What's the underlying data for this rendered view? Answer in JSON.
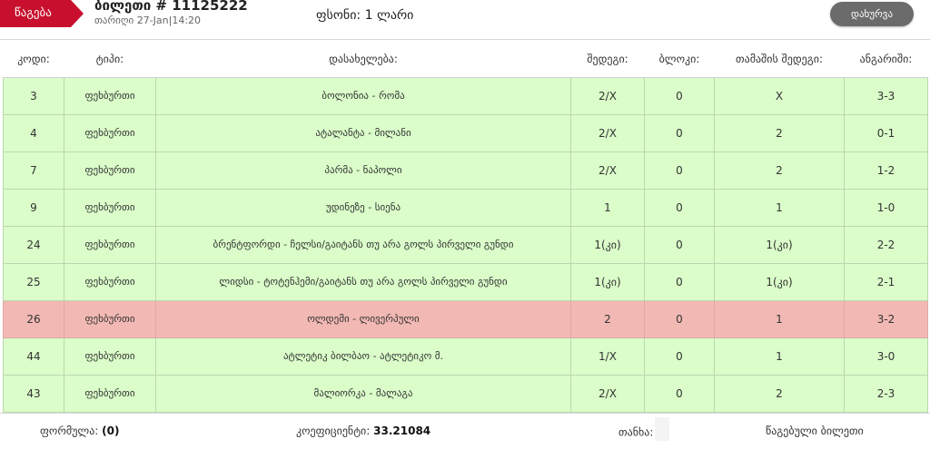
{
  "header": {
    "status_tag": "წაგება",
    "ticket_title": "ბილეთი # 11125222",
    "date_label": "თარიღი",
    "date_value": "27-Jan|14:20",
    "stake_label": "ფსონი:",
    "stake_value": "1 ლარი",
    "close_label": "დახურვა"
  },
  "table": {
    "columns": [
      "კოდი:",
      "ტიპი:",
      "დასახელება:",
      "შედეგი:",
      "ბლოკი:",
      "თამაშის შედეგი:",
      "ანგარიში:"
    ],
    "rows": [
      {
        "code": "3",
        "type": "ფეხბურთი",
        "name": "ბოლონია - რომა",
        "result": "2/X",
        "block": "0",
        "game_result": "X",
        "score": "3-3",
        "status": "won"
      },
      {
        "code": "4",
        "type": "ფეხბურთი",
        "name": "ატალანტა - მილანი",
        "result": "2/X",
        "block": "0",
        "game_result": "2",
        "score": "0-1",
        "status": "won"
      },
      {
        "code": "7",
        "type": "ფეხბურთი",
        "name": "პარმა - ნაპოლი",
        "result": "2/X",
        "block": "0",
        "game_result": "2",
        "score": "1-2",
        "status": "won"
      },
      {
        "code": "9",
        "type": "ფეხბურთი",
        "name": "უდინეზე - სიენა",
        "result": "1",
        "block": "0",
        "game_result": "1",
        "score": "1-0",
        "status": "won"
      },
      {
        "code": "24",
        "type": "ფეხბურთი",
        "name": "ბრენტფორდი - ჩელსი/გაიტანს თუ არა გოლს პირველი გუნდი",
        "result": "1(კი)",
        "block": "0",
        "game_result": "1(კი)",
        "score": "2-2",
        "status": "won"
      },
      {
        "code": "25",
        "type": "ფეხბურთი",
        "name": "ლიდსი - ტოტენჰემი/გაიტანს თუ არა გოლს პირველი გუნდი",
        "result": "1(კი)",
        "block": "0",
        "game_result": "1(კი)",
        "score": "2-1",
        "status": "won"
      },
      {
        "code": "26",
        "type": "ფეხბურთი",
        "name": "ოლდემი - ლივერპული",
        "result": "2",
        "block": "0",
        "game_result": "1",
        "score": "3-2",
        "status": "lost"
      },
      {
        "code": "44",
        "type": "ფეხბურთი",
        "name": "ატლეტიკ ბილბაო - ატლეტიკო მ.",
        "result": "1/X",
        "block": "0",
        "game_result": "1",
        "score": "3-0",
        "status": "won"
      },
      {
        "code": "43",
        "type": "ფეხბურთი",
        "name": "მალიორკა - მალაგა",
        "result": "2/X",
        "block": "0",
        "game_result": "2",
        "score": "2-3",
        "status": "won"
      }
    ]
  },
  "footer": {
    "formula_label": "ფორმულა:",
    "formula_value": "(0)",
    "coef_label": "კოეფიციენტი:",
    "coef_value": "33.21084",
    "amount_label": "თანხა:",
    "lost_ticket_label": "წაგებული ბილეთი"
  },
  "colors": {
    "accent_red": "#c8102e",
    "row_won": "#dafdc9",
    "row_lost": "#f2b8b3"
  }
}
